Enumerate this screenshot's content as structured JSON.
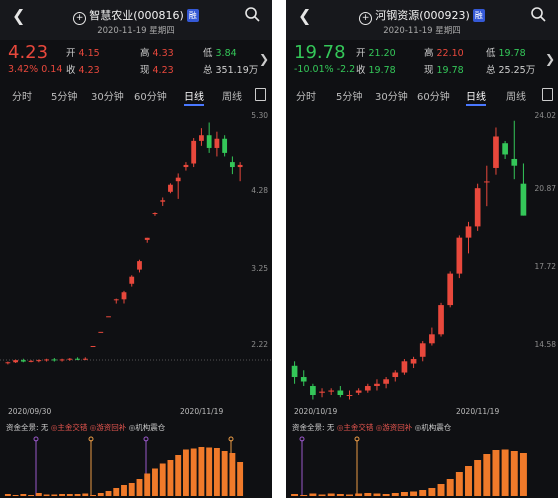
{
  "colors": {
    "up": "#e8483c",
    "down": "#34c759",
    "bar": "#f07a2a",
    "marker_purple": "#9a57c9",
    "marker_orange": "#e89a46"
  },
  "panels": [
    {
      "header": {
        "name": "智慧农业",
        "code": "(000816)",
        "tag": "融",
        "date": "2020-11-19 星期四"
      },
      "quote": {
        "price": "4.23",
        "change_pct": "3.42%",
        "change_abs": "0.14",
        "open_label": "开",
        "open": "4.15",
        "high_label": "高",
        "high": "4.33",
        "low_label": "低",
        "low": "3.84",
        "close_label": "收",
        "close": "4.23",
        "now_label": "现",
        "now": "4.23",
        "total_label": "总",
        "total": "351.19万",
        "direction": "up"
      },
      "tabs": [
        "分时",
        "5分钟",
        "30分钟",
        "60分钟",
        "日线",
        "周线"
      ],
      "active_tab": "日线",
      "y_labels": [
        "5.30",
        "4.28",
        "3.25",
        "2.22"
      ],
      "x_labels": [
        "2020/09/30",
        "2020/11/19"
      ],
      "funds": {
        "label": "资金全景:",
        "none": "无",
        "main": "主金交错",
        "hot": "游资回补",
        "inst": "机构震仓"
      },
      "chart_data": {
        "type": "candlestick",
        "ylim": [
          1.2,
          5.3
        ],
        "candles": [
          [
            1.78,
            1.8,
            1.76,
            1.79
          ],
          [
            1.79,
            1.83,
            1.78,
            1.82
          ],
          [
            1.82,
            1.84,
            1.79,
            1.8
          ],
          [
            1.8,
            1.82,
            1.79,
            1.81
          ],
          [
            1.81,
            1.83,
            1.79,
            1.82
          ],
          [
            1.82,
            1.84,
            1.8,
            1.83
          ],
          [
            1.83,
            1.85,
            1.8,
            1.82
          ],
          [
            1.82,
            1.84,
            1.8,
            1.83
          ],
          [
            1.83,
            1.85,
            1.81,
            1.84
          ],
          [
            1.84,
            1.86,
            1.82,
            1.83
          ],
          [
            1.83,
            1.86,
            1.82,
            1.84
          ],
          [
            2.02,
            2.02,
            2.02,
            2.02
          ],
          [
            2.22,
            2.22,
            2.22,
            2.22
          ],
          [
            2.44,
            2.44,
            2.44,
            2.44
          ],
          [
            2.68,
            2.69,
            2.62,
            2.68
          ],
          [
            2.68,
            2.8,
            2.62,
            2.78
          ],
          [
            2.9,
            3.02,
            2.86,
            3.0
          ],
          [
            3.1,
            3.24,
            3.06,
            3.22
          ],
          [
            3.52,
            3.55,
            3.48,
            3.55
          ],
          [
            3.9,
            3.91,
            3.86,
            3.9
          ],
          [
            4.06,
            4.12,
            4.0,
            4.08
          ],
          [
            4.2,
            4.32,
            4.18,
            4.3
          ],
          [
            4.35,
            4.46,
            4.1,
            4.4
          ],
          [
            4.55,
            4.62,
            4.5,
            4.58
          ],
          [
            4.6,
            4.96,
            4.55,
            4.92
          ],
          [
            4.92,
            5.1,
            4.85,
            5.0
          ],
          [
            5.0,
            5.18,
            4.75,
            4.82
          ],
          [
            4.82,
            5.05,
            4.7,
            4.95
          ],
          [
            4.95,
            5.0,
            4.7,
            4.75
          ],
          [
            4.62,
            4.7,
            4.45,
            4.55
          ],
          [
            4.55,
            4.62,
            4.35,
            4.58
          ]
        ],
        "funds": [
          0.04,
          0.01,
          0.04,
          0.02,
          0.06,
          0.03,
          0.03,
          0.04,
          0.04,
          0.04,
          0.05,
          0.02,
          0.06,
          0.1,
          0.16,
          0.22,
          0.26,
          0.34,
          0.45,
          0.55,
          0.65,
          0.72,
          0.82,
          0.93,
          0.95,
          0.98,
          0.97,
          0.96,
          0.9,
          0.86,
          0.68
        ],
        "markers": [
          [
            6,
            "purple"
          ],
          [
            17,
            "orange"
          ],
          [
            28,
            "purple"
          ],
          [
            45,
            "orange"
          ]
        ]
      }
    },
    {
      "header": {
        "name": "河钢资源",
        "code": "(000923)",
        "tag": "融",
        "date": "2020-11-19 星期四"
      },
      "quote": {
        "price": "19.78",
        "change_pct": "-10.01%",
        "change_abs": "-2.2",
        "open_label": "开",
        "open": "21.20",
        "high_label": "高",
        "high": "22.10",
        "low_label": "低",
        "low": "19.78",
        "close_label": "收",
        "close": "19.78",
        "now_label": "现",
        "now": "19.78",
        "total_label": "总",
        "total": "25.25万",
        "direction": "down"
      },
      "tabs": [
        "分时",
        "5分钟",
        "30分钟",
        "60分钟",
        "日线",
        "周线"
      ],
      "active_tab": "日线",
      "y_labels": [
        "24.02",
        "20.87",
        "17.72",
        "14.58"
      ],
      "x_labels": [
        "2020/10/19",
        "2020/11/19"
      ],
      "funds": {
        "label": "资金全景:",
        "none": "无",
        "main": "主金交错",
        "hot": "游资回补",
        "inst": "机构震仓"
      },
      "chart_data": {
        "type": "candlestick",
        "ylim": [
          11.4,
          24.3
        ],
        "candles": [
          [
            13.1,
            13.3,
            12.3,
            12.6
          ],
          [
            12.6,
            12.9,
            12.2,
            12.4
          ],
          [
            12.2,
            12.3,
            11.6,
            11.8
          ],
          [
            11.9,
            12.1,
            11.7,
            11.95
          ],
          [
            11.95,
            12.1,
            11.8,
            12.0
          ],
          [
            12.0,
            12.2,
            11.7,
            11.8
          ],
          [
            11.8,
            12.0,
            11.6,
            11.8
          ],
          [
            11.9,
            12.1,
            11.8,
            12.0
          ],
          [
            12.0,
            12.3,
            11.9,
            12.2
          ],
          [
            12.2,
            12.5,
            12.0,
            12.3
          ],
          [
            12.3,
            12.6,
            12.1,
            12.5
          ],
          [
            12.6,
            12.9,
            12.4,
            12.8
          ],
          [
            12.8,
            13.4,
            12.7,
            13.3
          ],
          [
            13.2,
            13.5,
            13.0,
            13.4
          ],
          [
            13.5,
            14.2,
            13.3,
            14.1
          ],
          [
            14.1,
            14.8,
            14.0,
            14.5
          ],
          [
            14.5,
            15.9,
            14.4,
            15.8
          ],
          [
            15.8,
            17.3,
            15.7,
            17.2
          ],
          [
            17.2,
            18.9,
            17.0,
            18.8
          ],
          [
            18.8,
            19.5,
            18.1,
            19.3
          ],
          [
            19.3,
            21.2,
            19.1,
            21.0
          ],
          [
            21.3,
            22.0,
            20.2,
            21.3
          ],
          [
            21.9,
            23.7,
            21.6,
            23.3
          ],
          [
            23.0,
            23.1,
            22.3,
            22.5
          ],
          [
            22.3,
            24.0,
            21.4,
            22.0
          ],
          [
            21.2,
            22.1,
            19.78,
            19.78
          ]
        ],
        "funds": [
          0.04,
          0.02,
          0.05,
          0.03,
          0.05,
          0.04,
          0.03,
          0.05,
          0.06,
          0.05,
          0.04,
          0.06,
          0.08,
          0.09,
          0.12,
          0.16,
          0.24,
          0.34,
          0.48,
          0.6,
          0.72,
          0.84,
          0.92,
          0.93,
          0.9,
          0.86
        ],
        "markers": [
          [
            2,
            "purple"
          ],
          [
            13,
            "orange"
          ]
        ]
      }
    }
  ]
}
